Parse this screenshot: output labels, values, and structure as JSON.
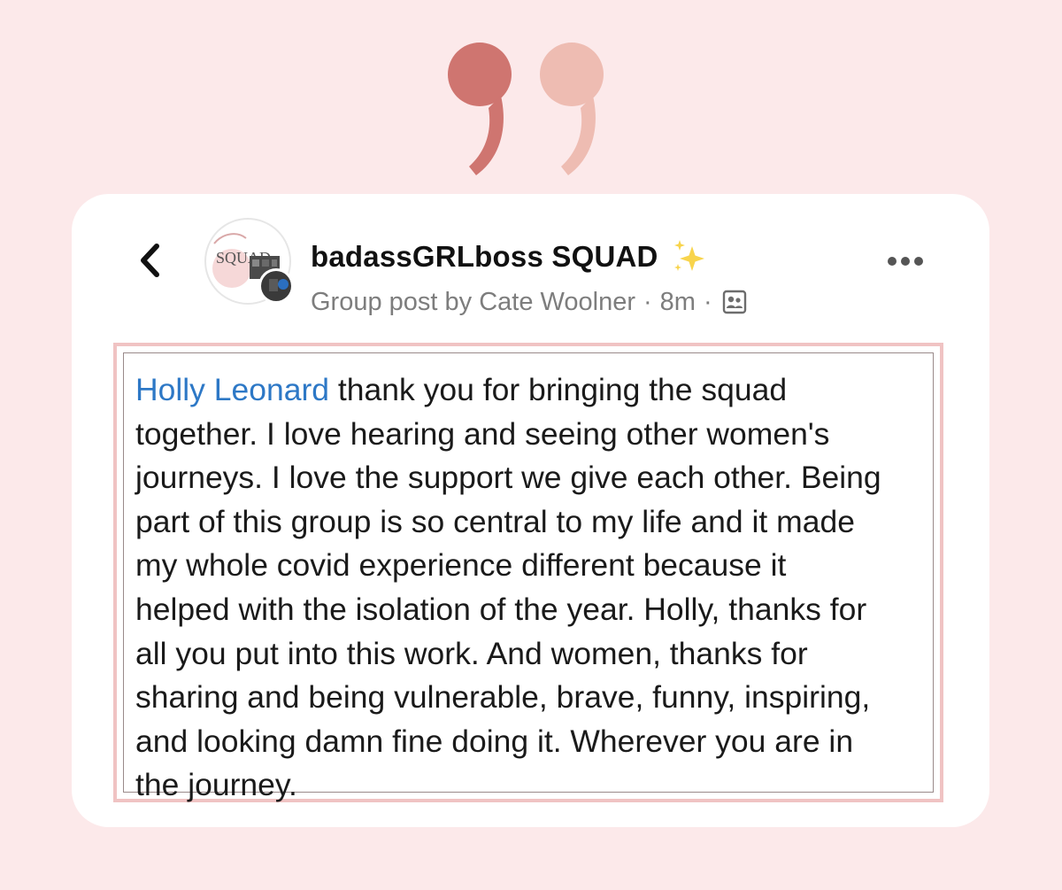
{
  "colors": {
    "background": "#fce9ea",
    "quote_dark": "#cf7570",
    "quote_light": "#eebcb2",
    "card": "#ffffff",
    "post_border": "#f0c3c3",
    "mention": "#2d78c6",
    "meta_text": "#7d7d7d"
  },
  "decor": {
    "quote_icon": "closing-quotation-mark",
    "back_icon": "chevron-left-icon",
    "sparkles_icon": "sparkles-emoji",
    "more_icon": "more-options-icon",
    "group_icon": "group-visibility-icon"
  },
  "header": {
    "group_name": "badassGRLboss SQUAD",
    "post_by": "Group post by Cate Woolner",
    "separator": "·",
    "time": "8m"
  },
  "avatar": {
    "logo_text": "SQUAD"
  },
  "post": {
    "mention": "Holly Leonard",
    "lines": [
      " thank you for bringing the squad",
      "together. I love hearing and seeing other women's",
      "journeys. I love the support we give each other. Being",
      "part of this group is so central to my life and it made",
      "my whole covid experience different because it",
      "helped with the isolation of the year. Holly, thanks for",
      "all you put into this work. And women, thanks for",
      "sharing and being vulnerable, brave, funny, inspiring,",
      "and looking damn fine doing it. Wherever you are in",
      "the journey."
    ]
  }
}
